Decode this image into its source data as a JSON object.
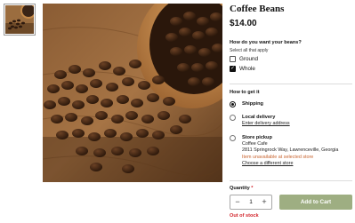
{
  "product": {
    "title": "Coffee Beans",
    "price": "$14.00"
  },
  "grind": {
    "question": "How do you want your beans?",
    "hint": "Select all that apply",
    "options": [
      {
        "label": "Ground",
        "checked": false
      },
      {
        "label": "Whole",
        "checked": true
      }
    ]
  },
  "fulfillment": {
    "heading": "How to get it",
    "shipping": {
      "label": "Shipping",
      "selected": true
    },
    "local_delivery": {
      "label": "Local delivery",
      "link": "Enter delivery address",
      "selected": false
    },
    "store_pickup": {
      "label": "Store pickup",
      "store_name": "Coffee Cafe",
      "address": "2811 Springrock Way, Lawrenceville, Georgia",
      "warning": "Item unavailable at selected store",
      "link": "Choose a different store",
      "selected": false
    }
  },
  "quantity": {
    "label": "Quantity",
    "required_mark": "*",
    "value": "1",
    "decrement": "−",
    "increment": "+"
  },
  "add_to_cart": {
    "label": "Add to Cart",
    "color": "#9eae82"
  },
  "stock_status": {
    "text": "Out of stock",
    "color": "#d2232a"
  },
  "icons": {
    "check": "checkmark-icon",
    "minus": "minus-icon",
    "plus": "plus-icon"
  }
}
